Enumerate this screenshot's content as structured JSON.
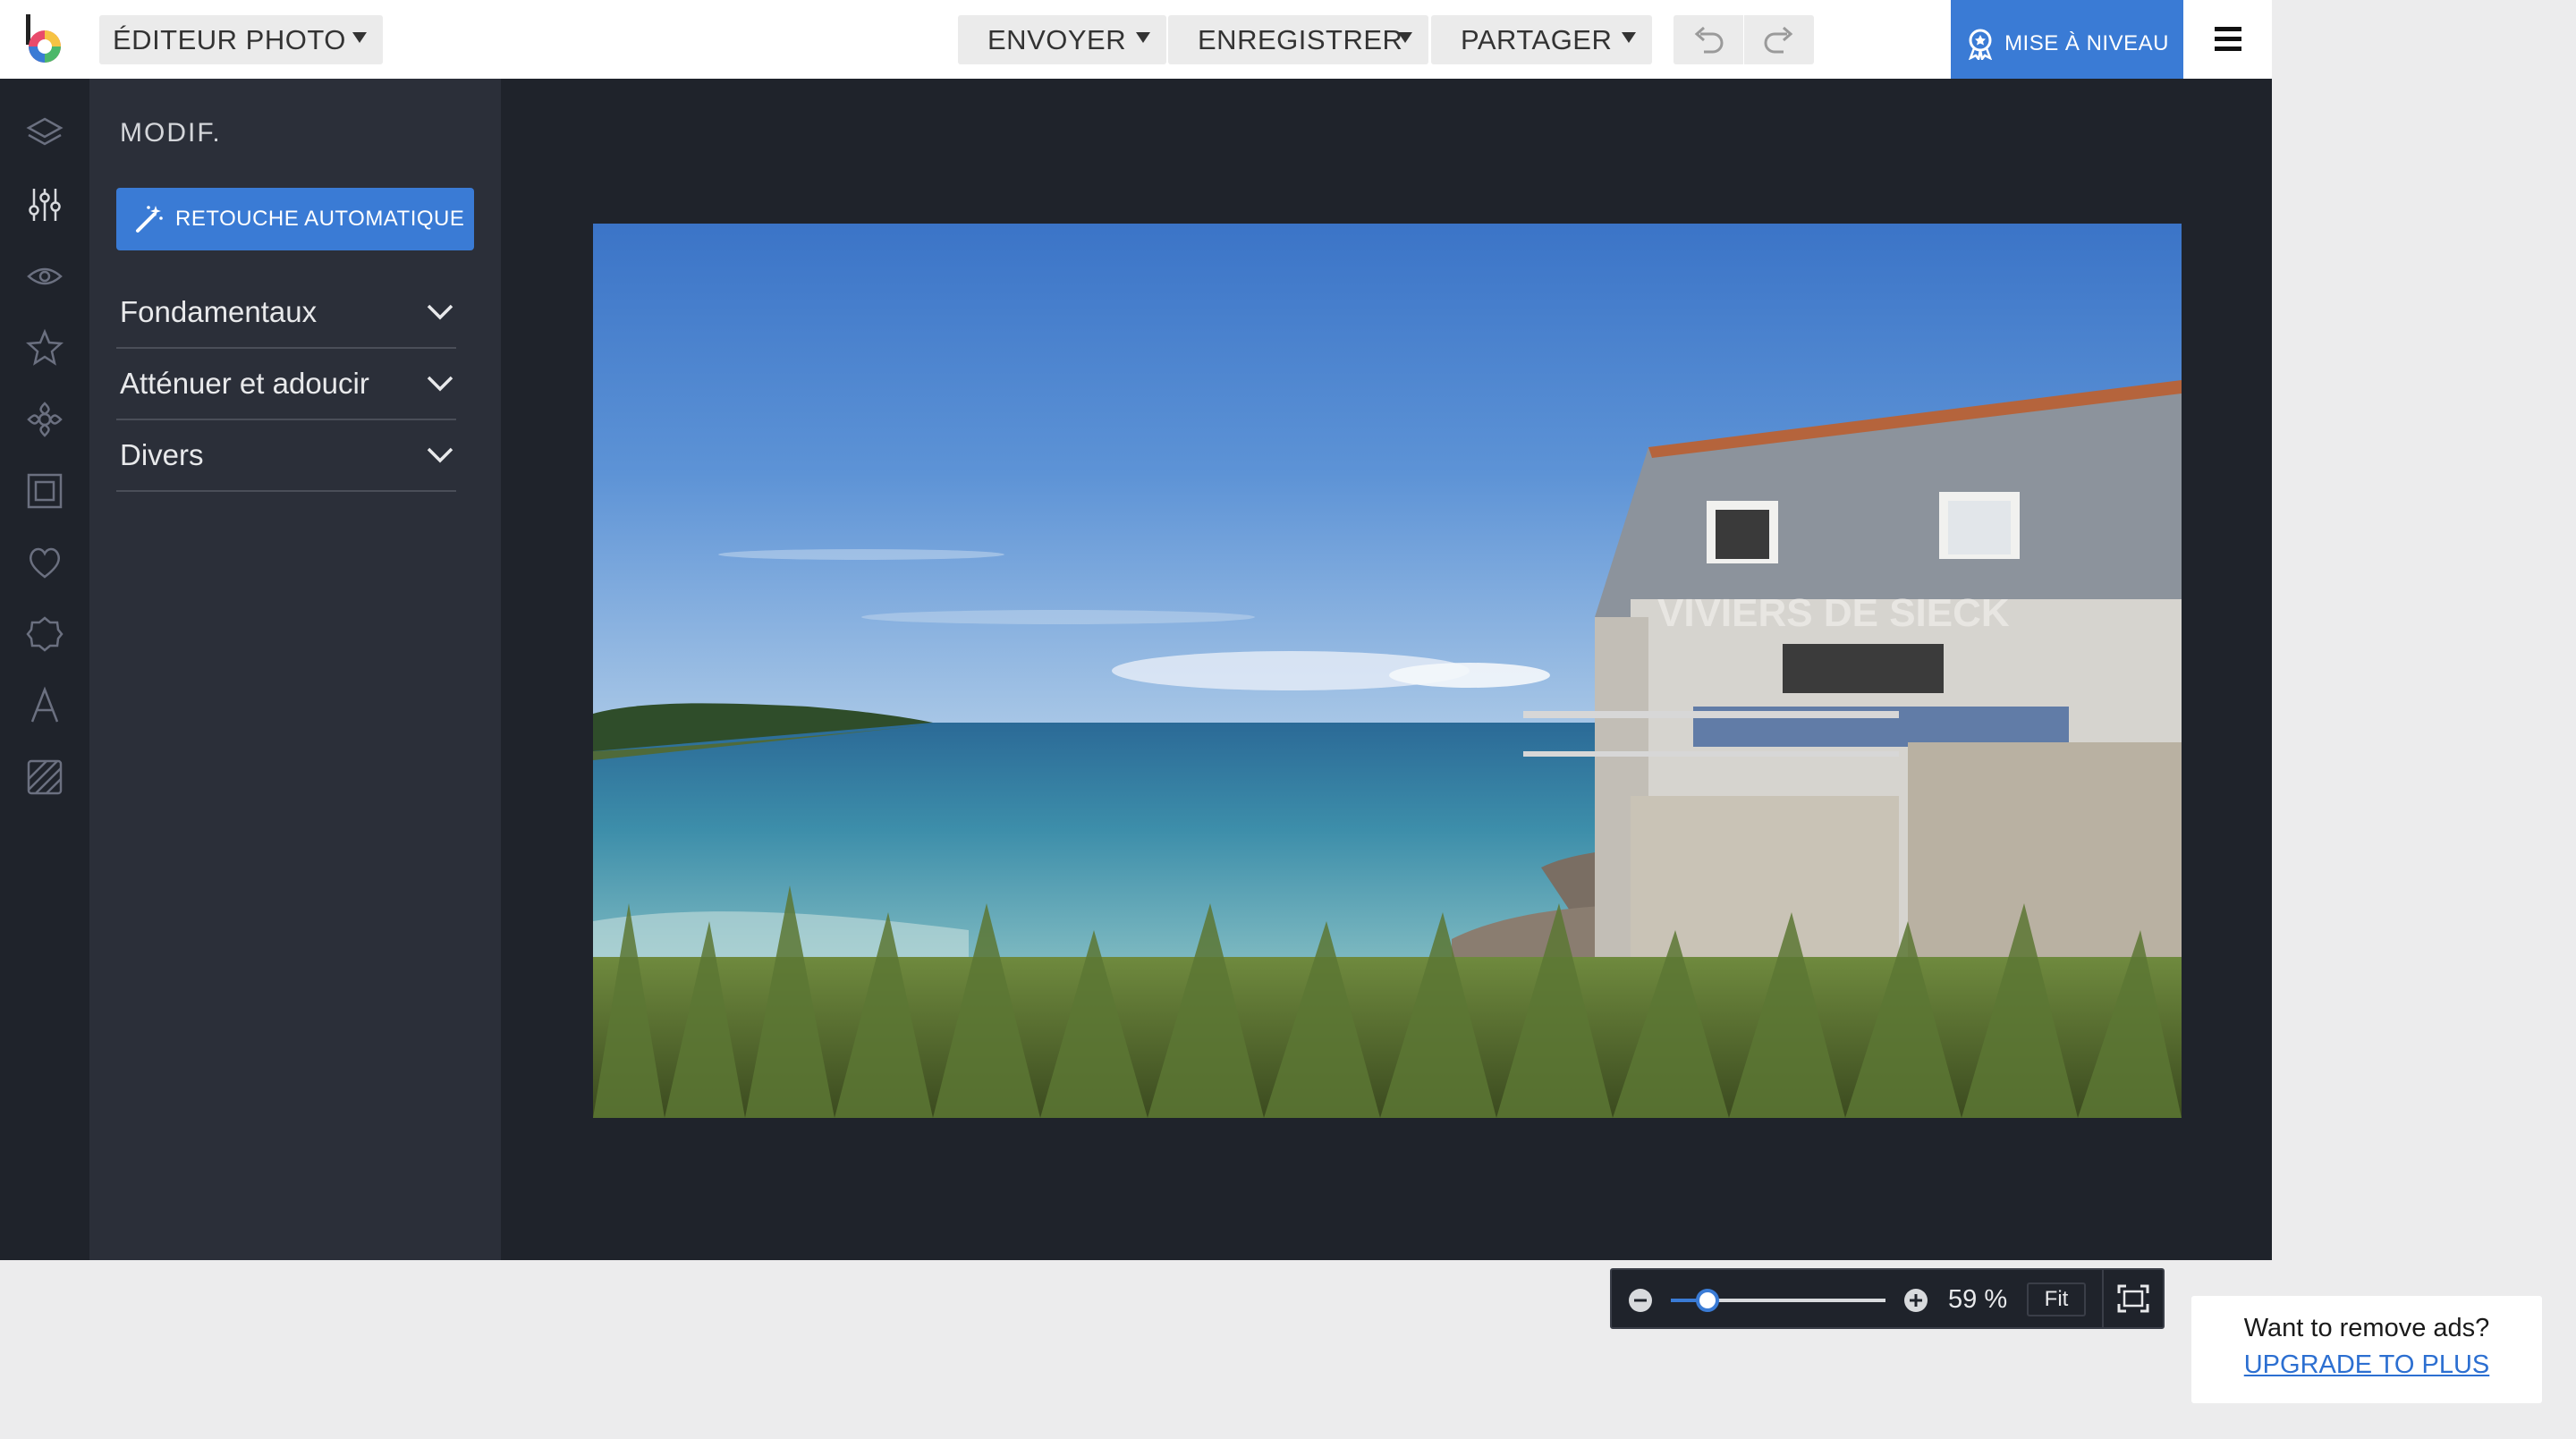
{
  "header": {
    "logo_icon": "befunky-logo-icon",
    "editor_label": "ÉDITEUR PHOTO",
    "envoyer_label": "ENVOYER",
    "enregistrer_label": "ENREGISTRER",
    "partager_label": "PARTAGER",
    "undo_icon": "undo-icon",
    "redo_icon": "redo-icon",
    "upgrade_label": "MISE À NIVEAU",
    "menu_icon": "hamburger-menu-icon"
  },
  "rail": {
    "icons": [
      "layers-icon",
      "sliders-icon",
      "eye-icon",
      "star-icon",
      "flower-icon",
      "frame-icon",
      "heart-icon",
      "badge-icon",
      "text-icon",
      "texture-icon"
    ],
    "active_index": 1
  },
  "panel": {
    "title": "MODIF.",
    "auto_button_label": "RETOUCHE AUTOMATIQUE",
    "sections": [
      {
        "label": "Fondamentaux"
      },
      {
        "label": "Atténuer et adoucir"
      },
      {
        "label": "Divers"
      }
    ]
  },
  "photo": {
    "sign_text": "VIVIERS DE SIECK"
  },
  "zoom": {
    "value_label": "59 %",
    "level": 0.17,
    "fit_label": "Fit"
  },
  "ad": {
    "text": "Want to remove ads?",
    "link": "UPGRADE TO PLUS"
  },
  "colors": {
    "accent": "#3a7bd5",
    "app_bg": "#1f232b",
    "panel_bg": "#2b2f39",
    "page_bg": "#ececed"
  }
}
